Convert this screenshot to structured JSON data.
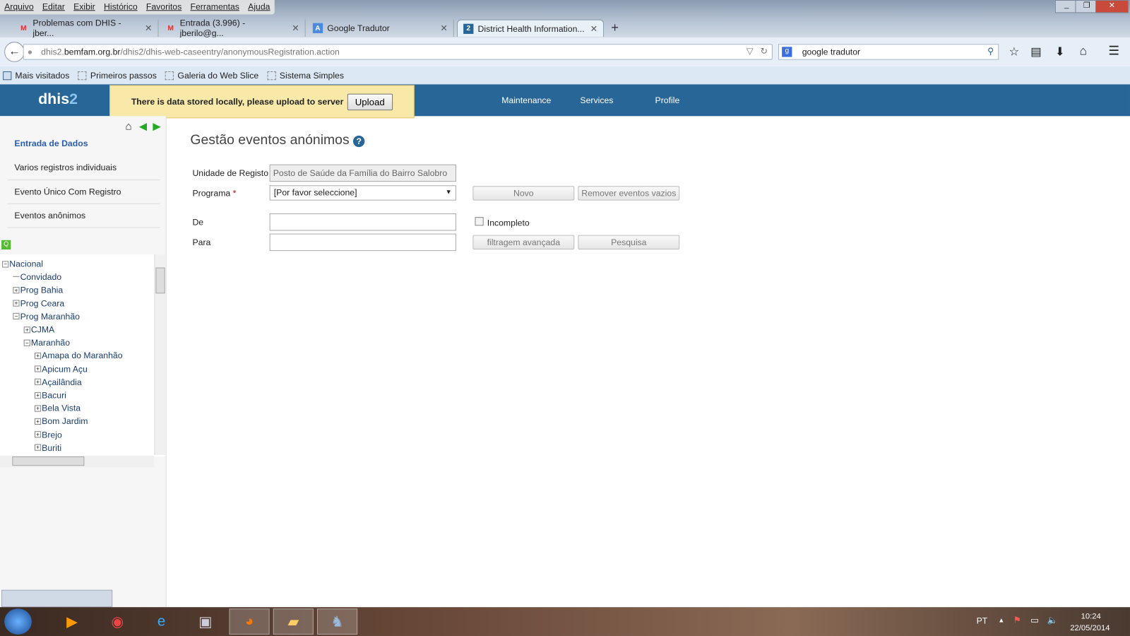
{
  "browser": {
    "menu": [
      "Arquivo",
      "Editar",
      "Exibir",
      "Histórico",
      "Favoritos",
      "Ferramentas",
      "Ajuda"
    ],
    "tabs": [
      {
        "label": "Problemas com DHIS - jber...",
        "icon": "gmail-icon"
      },
      {
        "label": "Entrada (3.996) - jberilo@g...",
        "icon": "gmail-icon"
      },
      {
        "label": "Google Tradutor",
        "icon": "translate-icon"
      },
      {
        "label": "District Health Information...",
        "icon": "dhis-icon"
      }
    ],
    "url_host": "dhis2.",
    "url_domain": "bemfam.org.br",
    "url_path": "/dhis2/dhis-web-caseentry/anonymousRegistration.action",
    "search_value": "google tradutor",
    "bookmarks": [
      "Mais visitados",
      "Primeiros passos",
      "Galeria do Web Slice",
      "Sistema Simples"
    ]
  },
  "app": {
    "logo_a": "dhis",
    "logo_b": "2",
    "notice": "There is data stored locally, please upload to server",
    "upload": "Upload",
    "nav": [
      "Maintenance",
      "Services",
      "Profile"
    ]
  },
  "sidebar": {
    "title": "Entrada de Dados",
    "items": [
      "Varios registros individuais",
      "Evento Único Com Registro",
      "Eventos anônimos"
    ],
    "tree": [
      {
        "label": "Nacional",
        "level": 0,
        "state": "-"
      },
      {
        "label": "Convidado",
        "level": 1,
        "state": ""
      },
      {
        "label": "Prog Bahia",
        "level": 1,
        "state": "+"
      },
      {
        "label": "Prog Ceara",
        "level": 1,
        "state": "+"
      },
      {
        "label": "Prog Maranhão",
        "level": 1,
        "state": "-"
      },
      {
        "label": "CJMA",
        "level": 2,
        "state": "+"
      },
      {
        "label": "Maranhão",
        "level": 2,
        "state": "-"
      },
      {
        "label": "Amapa do Maranhão",
        "level": 3,
        "state": "+"
      },
      {
        "label": "Apicum Açu",
        "level": 3,
        "state": "+"
      },
      {
        "label": "Açailândia",
        "level": 3,
        "state": "+"
      },
      {
        "label": "Bacuri",
        "level": 3,
        "state": "+"
      },
      {
        "label": "Bela Vista",
        "level": 3,
        "state": "+"
      },
      {
        "label": "Bom Jardim",
        "level": 3,
        "state": "+"
      },
      {
        "label": "Brejo",
        "level": 3,
        "state": "+"
      },
      {
        "label": "Buriti",
        "level": 3,
        "state": "+"
      }
    ]
  },
  "main": {
    "title": "Gestão eventos anónimos",
    "unidade_label": "Unidade de Registo",
    "unidade_value": "Posto de Saúde da Família do Bairro Salobro",
    "programa_label": "Programa",
    "required": "*",
    "programa_value": "[Por favor seleccione]",
    "novo": "Novo",
    "remover": "Remover eventos vazios",
    "de_label": "De",
    "para_label": "Para",
    "incompleto": "Incompleto",
    "filtragem": "filtragem avançada",
    "pesquisa": "Pesquisa"
  },
  "taskbar": {
    "lang": "PT",
    "time": "10:24",
    "date": "22/05/2014"
  }
}
